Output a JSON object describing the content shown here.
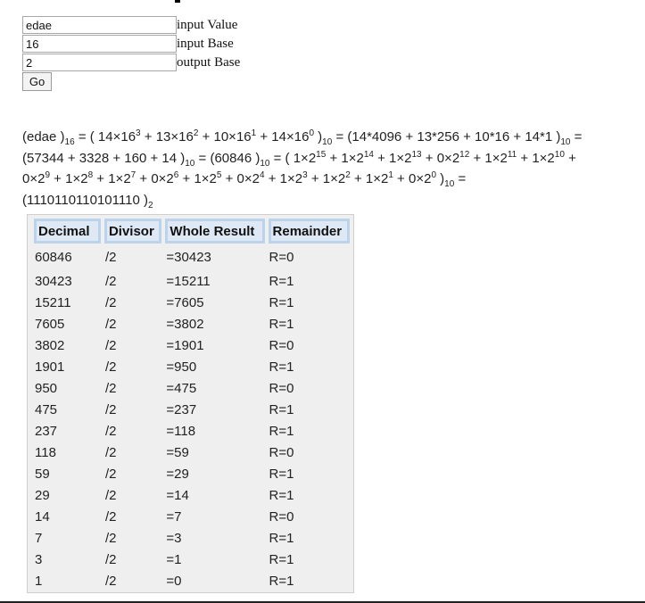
{
  "form": {
    "value_input": "edae",
    "value_label": "input Value",
    "base_input": "16",
    "base_label": "input Base",
    "output_input": "2",
    "output_label": "output Base",
    "go_label": "Go"
  },
  "expression": {
    "line1": [
      "(edae )",
      {
        "sub": "16"
      },
      " = ( 14×16",
      {
        "sup": "3"
      },
      " + 13×16",
      {
        "sup": "2"
      },
      " + 10×16",
      {
        "sup": "1"
      },
      " + 14×16",
      {
        "sup": "0"
      },
      " )",
      {
        "sub": "10"
      },
      " = (14*4096 + 13*256 + 10*16 + 14*1 )",
      {
        "sub": "10"
      },
      " ="
    ],
    "line2": [
      "(57344 + 3328 + 160 + 14 )",
      {
        "sub": "10"
      },
      " = (60846 )",
      {
        "sub": "10"
      },
      " = ( 1×2",
      {
        "sup": "15"
      },
      " + 1×2",
      {
        "sup": "14"
      },
      " + 1×2",
      {
        "sup": "13"
      },
      " + 0×2",
      {
        "sup": "12"
      },
      " + 1×2",
      {
        "sup": "11"
      },
      " + 1×2",
      {
        "sup": "10"
      },
      " +"
    ],
    "line3": [
      "0×2",
      {
        "sup": "9"
      },
      " + 1×2",
      {
        "sup": "8"
      },
      " + 1×2",
      {
        "sup": "7"
      },
      " + 0×2",
      {
        "sup": "6"
      },
      " + 1×2",
      {
        "sup": "5"
      },
      " + 0×2",
      {
        "sup": "4"
      },
      " + 1×2",
      {
        "sup": "3"
      },
      " + 1×2",
      {
        "sup": "2"
      },
      " + 1×2",
      {
        "sup": "1"
      },
      " + 0×2",
      {
        "sup": "0"
      },
      " )",
      {
        "sub": "10"
      },
      " ="
    ],
    "line4": [
      "(1110110110101110 )",
      {
        "sub": "2"
      }
    ]
  },
  "table": {
    "headers": [
      "Decimal",
      "Divisor",
      "Whole Result",
      "Remainder"
    ],
    "rows": [
      [
        "60846",
        "/2",
        "=30423",
        "R=0"
      ],
      [
        "30423",
        "/2",
        "=15211",
        "R=1"
      ],
      [
        "15211",
        "/2",
        "=7605",
        "R=1"
      ],
      [
        "7605",
        "/2",
        "=3802",
        "R=1"
      ],
      [
        "3802",
        "/2",
        "=1901",
        "R=0"
      ],
      [
        "1901",
        "/2",
        "=950",
        "R=1"
      ],
      [
        "950",
        "/2",
        "=475",
        "R=0"
      ],
      [
        "475",
        "/2",
        "=237",
        "R=1"
      ],
      [
        "237",
        "/2",
        "=118",
        "R=1"
      ],
      [
        "118",
        "/2",
        "=59",
        "R=0"
      ],
      [
        "59",
        "/2",
        "=29",
        "R=1"
      ],
      [
        "29",
        "/2",
        "=14",
        "R=1"
      ],
      [
        "14",
        "/2",
        "=7",
        "R=0"
      ],
      [
        "7",
        "/2",
        "=3",
        "R=1"
      ],
      [
        "3",
        "/2",
        "=1",
        "R=1"
      ],
      [
        "1",
        "/2",
        "=0",
        "R=1"
      ]
    ]
  }
}
